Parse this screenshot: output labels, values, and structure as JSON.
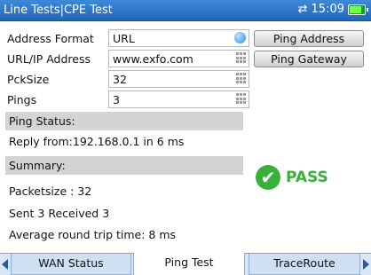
{
  "title_bar": {
    "title": "Line Tests|CPE Test",
    "time": "15:09",
    "battery_level_percent": 85
  },
  "form": {
    "address_format": {
      "label": "Address Format",
      "value": "URL"
    },
    "url_ip": {
      "label": "URL/IP Address",
      "value": "www.exfo.com"
    },
    "pck_size": {
      "label": "PckSize",
      "value": "32"
    },
    "pings": {
      "label": "Pings",
      "value": "3"
    }
  },
  "buttons": {
    "ping_address": "Ping Address",
    "ping_gateway": "Ping Gateway"
  },
  "ping_status": {
    "header": "Ping Status:",
    "reply": "Reply from:192.168.0.1 in  6  ms"
  },
  "summary": {
    "header": "Summary:",
    "packetsize": "Packetsize : 32",
    "sent_received": "Sent  3  Received  3",
    "avg_rtt": "Average round trip time: 8  ms"
  },
  "result": {
    "text": "PASS",
    "color": "#39b03a"
  },
  "tabs": [
    {
      "label": "WAN Status",
      "active": false
    },
    {
      "label": "Ping Test",
      "active": true
    },
    {
      "label": "TraceRoute",
      "active": false
    }
  ],
  "colors": {
    "title_bar": "#2f78c8",
    "pass": "#39b03a",
    "section_bg": "#d4d4d4"
  }
}
